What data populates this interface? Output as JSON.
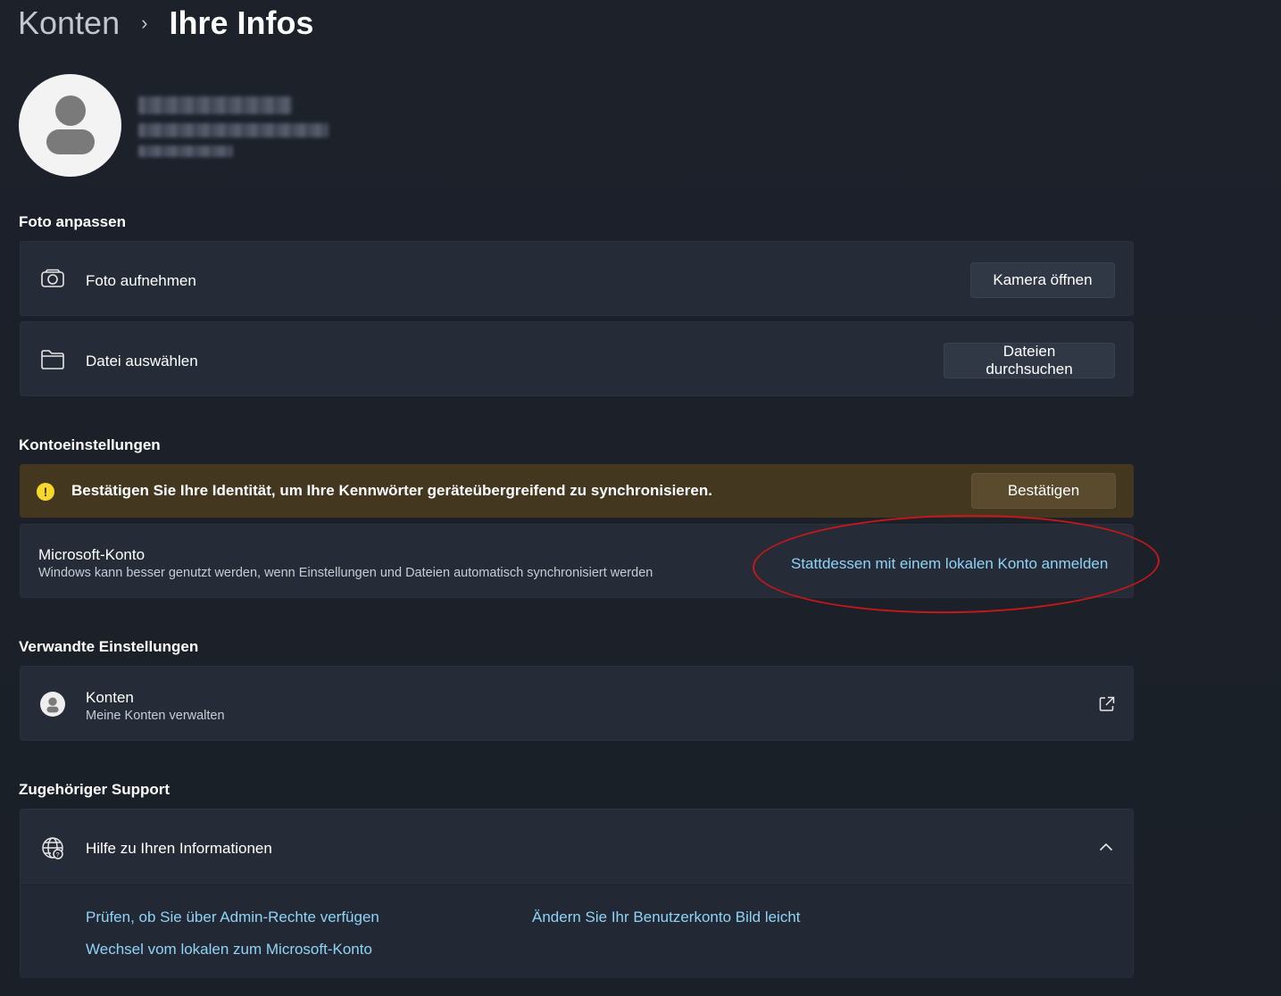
{
  "breadcrumb": {
    "parent": "Konten",
    "separator": "›",
    "current": "Ihre Infos"
  },
  "profile": {
    "avatar_icon": "person-icon"
  },
  "photo_section": {
    "title": "Foto anpassen",
    "take_photo_label": "Foto aufnehmen",
    "take_photo_icon": "camera-icon",
    "open_camera_button": "Kamera öffnen",
    "choose_file_label": "Datei auswählen",
    "choose_file_icon": "folder-icon",
    "browse_files_button": "Dateien durchsuchen"
  },
  "account_settings": {
    "title": "Kontoeinstellungen",
    "warning_text": "Bestätigen Sie Ihre Identität, um Ihre Kennwörter geräteübergreifend zu synchronisieren.",
    "warning_icon_glyph": "!",
    "confirm_button": "Bestätigen",
    "ms_account_title": "Microsoft-Konto",
    "ms_account_desc": "Windows kann besser genutzt werden, wenn Einstellungen und Dateien automatisch synchronisiert werden",
    "local_account_link": "Stattdessen mit einem lokalen Konto anmelden"
  },
  "related_settings": {
    "title": "Verwandte Einstellungen",
    "accounts_title": "Konten",
    "accounts_desc": "Meine Konten verwalten",
    "accounts_icon": "user-avatar-icon",
    "external_icon": "open-external-icon"
  },
  "support": {
    "title": "Zugehöriger Support",
    "help_title": "Hilfe zu Ihren Informationen",
    "help_icon": "globe-help-icon",
    "collapse_icon": "chevron-up-icon",
    "links": [
      "Prüfen, ob Sie über Admin-Rechte verfügen",
      "Ändern Sie Ihr Benutzerkonto Bild leicht",
      "Wechsel vom lokalen zum Microsoft-Konto"
    ]
  },
  "colors": {
    "background": "#1b2029",
    "card": "#262c37",
    "warning_bg": "#433720",
    "warning_icon": "#f8d72a",
    "link": "#8fd3f6",
    "annotation": "#c4181a"
  }
}
